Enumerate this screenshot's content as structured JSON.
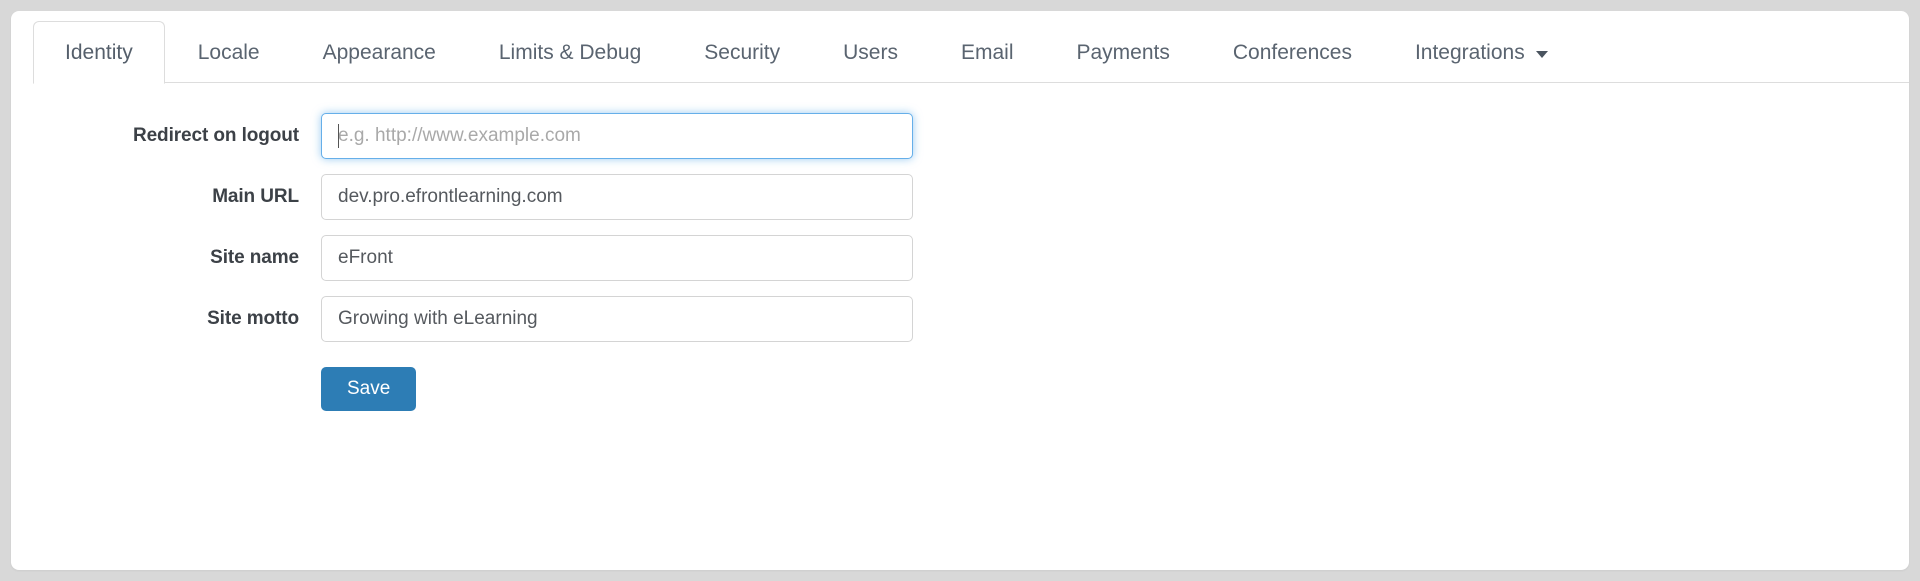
{
  "theme": {
    "page_background": "#d8d8d8",
    "panel_background": "#ffffff",
    "accent": "#2d7db5",
    "focus_border": "#66afe9",
    "border": "#dddddd",
    "label_color": "#3c4147",
    "tab_text_color": "#5a6470"
  },
  "tabs": [
    {
      "label": "Identity",
      "active": true
    },
    {
      "label": "Locale",
      "active": false
    },
    {
      "label": "Appearance",
      "active": false
    },
    {
      "label": "Limits & Debug",
      "active": false
    },
    {
      "label": "Security",
      "active": false
    },
    {
      "label": "Users",
      "active": false
    },
    {
      "label": "Email",
      "active": false
    },
    {
      "label": "Payments",
      "active": false
    },
    {
      "label": "Conferences",
      "active": false
    },
    {
      "label": "Integrations",
      "active": false,
      "has_dropdown": true
    }
  ],
  "form": {
    "fields": [
      {
        "label": "Redirect on logout",
        "value": "",
        "placeholder": "e.g. http://www.example.com",
        "focused": true
      },
      {
        "label": "Main URL",
        "value": "dev.pro.efrontlearning.com",
        "placeholder": "",
        "focused": false
      },
      {
        "label": "Site name",
        "value": "eFront",
        "placeholder": "",
        "focused": false
      },
      {
        "label": "Site motto",
        "value": "Growing with eLearning",
        "placeholder": "",
        "focused": false
      }
    ],
    "save_label": "Save"
  }
}
